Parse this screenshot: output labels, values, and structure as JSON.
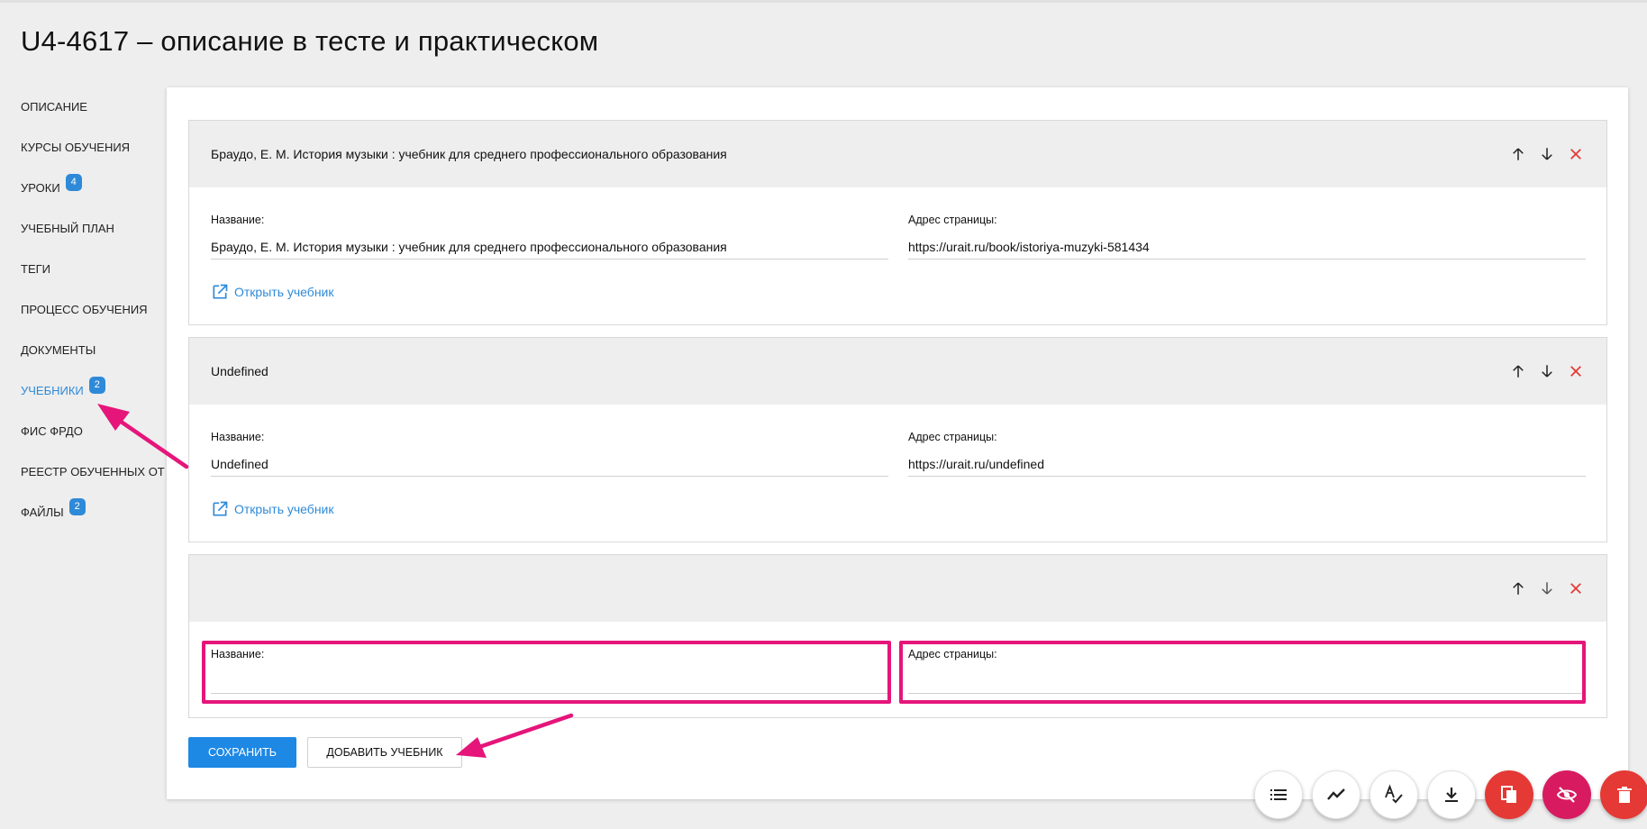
{
  "page": {
    "title": "U4-4617 – описание в тесте и практическом"
  },
  "sidebar": {
    "items": [
      {
        "label": "ОПИСАНИЕ",
        "badge": null,
        "active": false
      },
      {
        "label": "КУРСЫ ОБУЧЕНИЯ",
        "badge": null,
        "active": false
      },
      {
        "label": "УРОКИ",
        "badge": "4",
        "active": false
      },
      {
        "label": "УЧЕБНЫЙ ПЛАН",
        "badge": null,
        "active": false
      },
      {
        "label": "ТЕГИ",
        "badge": null,
        "active": false
      },
      {
        "label": "ПРОЦЕСС ОБУЧЕНИЯ",
        "badge": null,
        "active": false
      },
      {
        "label": "ДОКУМЕНТЫ",
        "badge": null,
        "active": false
      },
      {
        "label": "УЧЕБНИКИ",
        "badge": "2",
        "active": true
      },
      {
        "label": "ФИС ФРДО",
        "badge": null,
        "active": false
      },
      {
        "label": "РЕЕСТР ОБУЧЕННЫХ ОТ",
        "badge": null,
        "active": false
      },
      {
        "label": "ФАЙЛЫ",
        "badge": "2",
        "active": false
      }
    ]
  },
  "books": [
    {
      "header": "Браудо, Е. М. История музыки : учебник для среднего профессионального образования",
      "name_label": "Название:",
      "name_value": "Браудо, Е. М. История музыки : учебник для среднего профессионального образования",
      "url_label": "Адрес страницы:",
      "url_value": "https://urait.ru/book/istoriya-muzyki-581434",
      "open_link": "Открыть учебник"
    },
    {
      "header": "Undefined",
      "name_label": "Название:",
      "name_value": "Undefined",
      "url_label": "Адрес страницы:",
      "url_value": "https://urait.ru/undefined",
      "open_link": "Открыть учебник"
    },
    {
      "header": "",
      "name_label": "Название:",
      "name_value": "",
      "url_label": "Адрес страницы:",
      "url_value": ""
    }
  ],
  "actions": {
    "save_label": "СОХРАНИТЬ",
    "add_label": "ДОБАВИТЬ УЧЕБНИК"
  },
  "fab_buttons": [
    {
      "icon": "list-icon",
      "color": "#ffffff"
    },
    {
      "icon": "trend-icon",
      "color": "#ffffff"
    },
    {
      "icon": "spellcheck-icon",
      "color": "#ffffff"
    },
    {
      "icon": "download-icon",
      "color": "#ffffff"
    },
    {
      "icon": "copy-icon",
      "color": "#e53935"
    },
    {
      "icon": "visibility-off-icon",
      "color": "#d81b60"
    },
    {
      "icon": "delete-icon",
      "color": "#e53935"
    }
  ],
  "colors": {
    "accent": "#1e88e5",
    "highlight": "#e5157a",
    "danger": "#e53935"
  }
}
